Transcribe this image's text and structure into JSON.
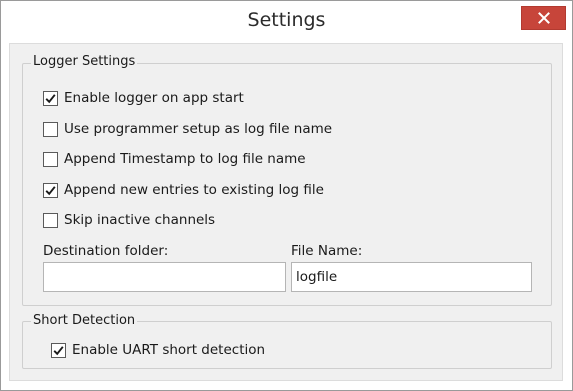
{
  "window": {
    "title": "Settings"
  },
  "logger_group": {
    "title": "Logger Settings",
    "options": [
      {
        "label": "Enable logger on app start",
        "checked": true
      },
      {
        "label": "Use programmer setup as log file name",
        "checked": false
      },
      {
        "label": "Append Timestamp to log file name",
        "checked": false
      },
      {
        "label": "Append new entries to existing log file",
        "checked": true
      },
      {
        "label": "Skip inactive channels",
        "checked": false
      }
    ],
    "destination_label": "Destination folder:",
    "destination_value": "",
    "filename_label": "File Name:",
    "filename_value": "logfile"
  },
  "short_group": {
    "title": "Short Detection",
    "option": {
      "label": "Enable UART short detection",
      "checked": true
    }
  },
  "colors": {
    "close_button": "#c7453a",
    "client_bg": "#f0f0f0"
  }
}
